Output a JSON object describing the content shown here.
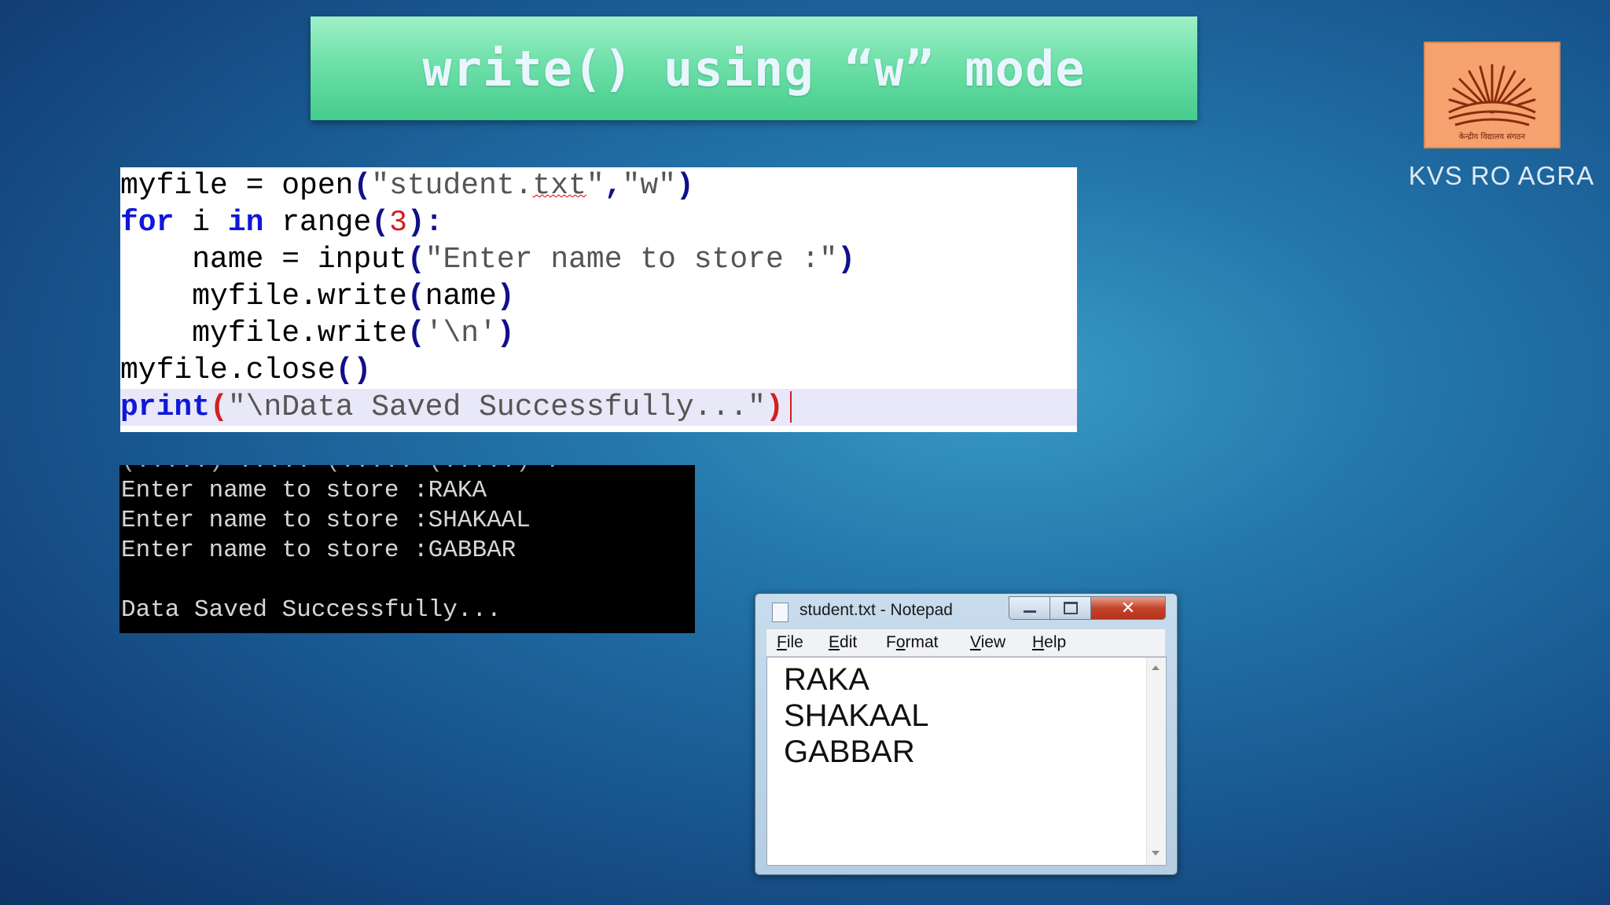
{
  "slide": {
    "title": "write() using “w” mode"
  },
  "logo": {
    "icon": "kvs-emblem-icon",
    "hindi_text": "केन्द्रीय विद्यालय संगठन",
    "caption": "KVS RO AGRA",
    "background": "#f6a26f"
  },
  "code_panel": {
    "lines": [
      {
        "indent": "",
        "parts": [
          {
            "t": "myfile = open",
            "c": "plain"
          },
          {
            "t": "(",
            "c": "br"
          },
          {
            "t": "\"student.",
            "c": "str"
          },
          {
            "t": "txt",
            "c": "str squig"
          },
          {
            "t": "\"",
            "c": "str"
          },
          {
            "t": ",",
            "c": "br"
          },
          {
            "t": "\"w\"",
            "c": "str"
          },
          {
            "t": ")",
            "c": "br"
          }
        ]
      },
      {
        "indent": "",
        "parts": [
          {
            "t": "for",
            "c": "kw"
          },
          {
            "t": " i ",
            "c": "plain"
          },
          {
            "t": "in",
            "c": "kw"
          },
          {
            "t": " range",
            "c": "plain"
          },
          {
            "t": "(",
            "c": "br"
          },
          {
            "t": "3",
            "c": "num"
          },
          {
            "t": "):",
            "c": "br"
          }
        ]
      },
      {
        "indent": "    ",
        "parts": [
          {
            "t": "name = input",
            "c": "plain"
          },
          {
            "t": "(",
            "c": "br"
          },
          {
            "t": "\"Enter name to store :\"",
            "c": "str"
          },
          {
            "t": ")",
            "c": "br"
          }
        ]
      },
      {
        "indent": "    ",
        "parts": [
          {
            "t": "myfile.write",
            "c": "plain"
          },
          {
            "t": "(",
            "c": "br"
          },
          {
            "t": "name",
            "c": "plain"
          },
          {
            "t": ")",
            "c": "br"
          }
        ]
      },
      {
        "indent": "    ",
        "parts": [
          {
            "t": "myfile.write",
            "c": "plain"
          },
          {
            "t": "(",
            "c": "br"
          },
          {
            "t": "'\\n'",
            "c": "str"
          },
          {
            "t": ")",
            "c": "br"
          }
        ]
      },
      {
        "indent": "",
        "parts": [
          {
            "t": "myfile.close",
            "c": "plain"
          },
          {
            "t": "()",
            "c": "br"
          }
        ]
      },
      {
        "indent": "",
        "highlight": true,
        "caret": true,
        "parts": [
          {
            "t": "print",
            "c": "kw"
          },
          {
            "t": "(",
            "c": "rbr"
          },
          {
            "t": "\"\\nData Saved Successfully...\"",
            "c": "str"
          },
          {
            "t": ")",
            "c": "rbr"
          }
        ]
      }
    ]
  },
  "console": {
    "partial_top": "(.....) ..... (..... (.....) .",
    "lines": [
      "Enter name to store :RAKA",
      "Enter name to store :SHAKAAL",
      "Enter name to store :GABBAR",
      "",
      "Data Saved Successfully..."
    ]
  },
  "notepad": {
    "title": "student.txt - Notepad",
    "doc_icon": "text-document-icon",
    "buttons": {
      "minimize": "minimize-icon",
      "maximize": "maximize-icon",
      "close_label": "✕"
    },
    "menu": [
      {
        "mnemonic": "F",
        "rest": "ile"
      },
      {
        "mnemonic": "E",
        "rest": "dit"
      },
      {
        "mnemonic": "",
        "pre": "F",
        "mid": "o",
        "rest": "rmat"
      },
      {
        "mnemonic": "V",
        "rest": "iew"
      },
      {
        "mnemonic": "H",
        "rest": "elp"
      }
    ],
    "content": [
      "RAKA",
      "SHAKAAL",
      "GABBAR"
    ]
  }
}
